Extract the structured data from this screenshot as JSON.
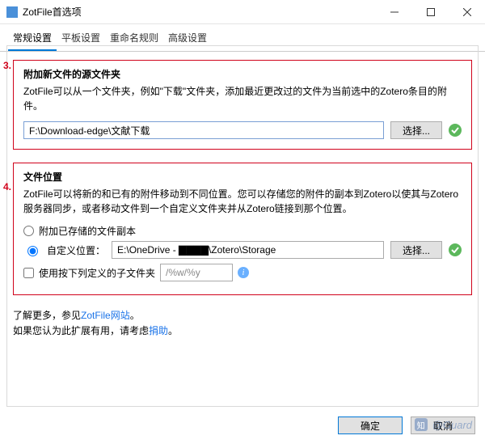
{
  "window": {
    "title": "ZotFile首选项"
  },
  "tabs": {
    "general": "常规设置",
    "tablet": "平板设置",
    "rename": "重命名规则",
    "advanced": "高级设置"
  },
  "annotations": {
    "n3": "3.",
    "n4": "4."
  },
  "source": {
    "title": "附加新文件的源文件夹",
    "desc": "ZotFile可以从一个文件夹，例如\"下载\"文件夹，添加最近更改过的文件为当前选中的Zotero条目的附件。",
    "path_value": "F:\\Download-edge\\文献下载",
    "choose_label": "选择..."
  },
  "location": {
    "title": "文件位置",
    "desc": "ZotFile可以将新的和已有的附件移动到不同位置。您可以存储您的附件的副本到Zotero以使其与Zotero服务器同步，或者移动文件到一个自定义文件夹并从Zotero链接到那个位置。",
    "radio_attach": "附加已存储的文件副本",
    "radio_custom": "自定义位置：",
    "custom_path_value": "E:\\OneDrive - ▇▇▇▇\\Zotero\\Storage",
    "choose_label": "选择...",
    "subfolder_label": "使用按下列定义的子文件夹",
    "subfolder_pattern": "/%w/%y"
  },
  "learn": {
    "prefix": "了解更多，参见",
    "site_link": "ZotFile网站",
    "period": "。",
    "line2_a": "如果您认为此扩展有用，请考虑",
    "donate_link": "捐助",
    "line2_b": "。"
  },
  "footer": {
    "ok": "确定",
    "cancel": "取消"
  },
  "watermark": {
    "text": "@Guard"
  }
}
